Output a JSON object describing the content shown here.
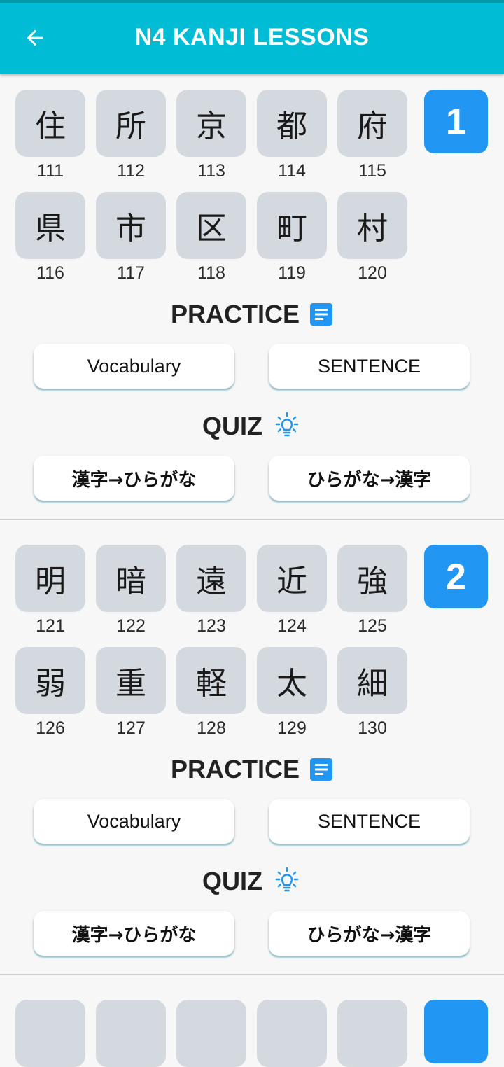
{
  "app_bar": {
    "title": "N4 KANJI LESSONS",
    "back_icon": "arrow-left-icon",
    "color": "#00bcd4"
  },
  "lessons": [
    {
      "badge": "1",
      "kanji": [
        {
          "char": "住",
          "num": "111"
        },
        {
          "char": "所",
          "num": "112"
        },
        {
          "char": "京",
          "num": "113"
        },
        {
          "char": "都",
          "num": "114"
        },
        {
          "char": "府",
          "num": "115"
        },
        {
          "char": "県",
          "num": "116"
        },
        {
          "char": "市",
          "num": "117"
        },
        {
          "char": "区",
          "num": "118"
        },
        {
          "char": "町",
          "num": "119"
        },
        {
          "char": "村",
          "num": "120"
        }
      ],
      "practice_label": "PRACTICE",
      "practice_icon": "document-list-icon",
      "vocab_btn": "Vocabulary",
      "sentence_btn": "SENTENCE",
      "quiz_label": "QUIZ",
      "quiz_icon": "lightbulb-icon",
      "quiz_k2h": "漢字→ひらがな",
      "quiz_h2k": "ひらがな→漢字"
    },
    {
      "badge": "2",
      "kanji": [
        {
          "char": "明",
          "num": "121"
        },
        {
          "char": "暗",
          "num": "122"
        },
        {
          "char": "遠",
          "num": "123"
        },
        {
          "char": "近",
          "num": "124"
        },
        {
          "char": "強",
          "num": "125"
        },
        {
          "char": "弱",
          "num": "126"
        },
        {
          "char": "重",
          "num": "127"
        },
        {
          "char": "軽",
          "num": "128"
        },
        {
          "char": "太",
          "num": "129"
        },
        {
          "char": "細",
          "num": "130"
        }
      ],
      "practice_label": "PRACTICE",
      "practice_icon": "document-list-icon",
      "vocab_btn": "Vocabulary",
      "sentence_btn": "SENTENCE",
      "quiz_label": "QUIZ",
      "quiz_icon": "lightbulb-icon",
      "quiz_k2h": "漢字→ひらがな",
      "quiz_h2k": "ひらがな→漢字"
    }
  ],
  "colors": {
    "accent": "#2196f3",
    "tile": "#d3d9df",
    "background": "#f7f7f7"
  }
}
